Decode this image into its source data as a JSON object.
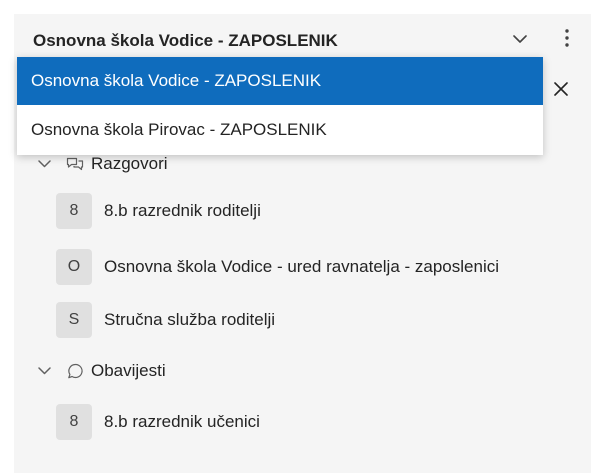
{
  "header": {
    "title": "Osnovna škola Vodice - ZAPOSLENIK",
    "chevron_icon": "chevron-down-icon",
    "more_icon": "more-vertical-icon",
    "close_icon": "close-icon"
  },
  "dropdown": {
    "options": [
      {
        "label": "Osnovna škola Vodice - ZAPOSLENIK",
        "selected": true
      },
      {
        "label": "Osnovna škola Pirovac - ZAPOSLENIK",
        "selected": false
      }
    ]
  },
  "groups": [
    {
      "label": "Razgovori",
      "icon": "chat-multiple-icon",
      "expanded": true,
      "items": [
        {
          "initial": "8",
          "label": "8.b razrednik roditelji"
        },
        {
          "initial": "O",
          "label": "Osnovna škola Vodice - ured ravnatelja - zaposlenici"
        },
        {
          "initial": "S",
          "label": "Stručna služba roditelji"
        }
      ]
    },
    {
      "label": "Obavijesti",
      "icon": "chat-bubble-icon",
      "expanded": true,
      "items": [
        {
          "initial": "8",
          "label": "8.b razrednik učenici"
        }
      ]
    }
  ],
  "colors": {
    "accent": "#0f6cbd",
    "panel_bg": "#f5f5f5",
    "avatar_bg": "#e0e0e0"
  }
}
